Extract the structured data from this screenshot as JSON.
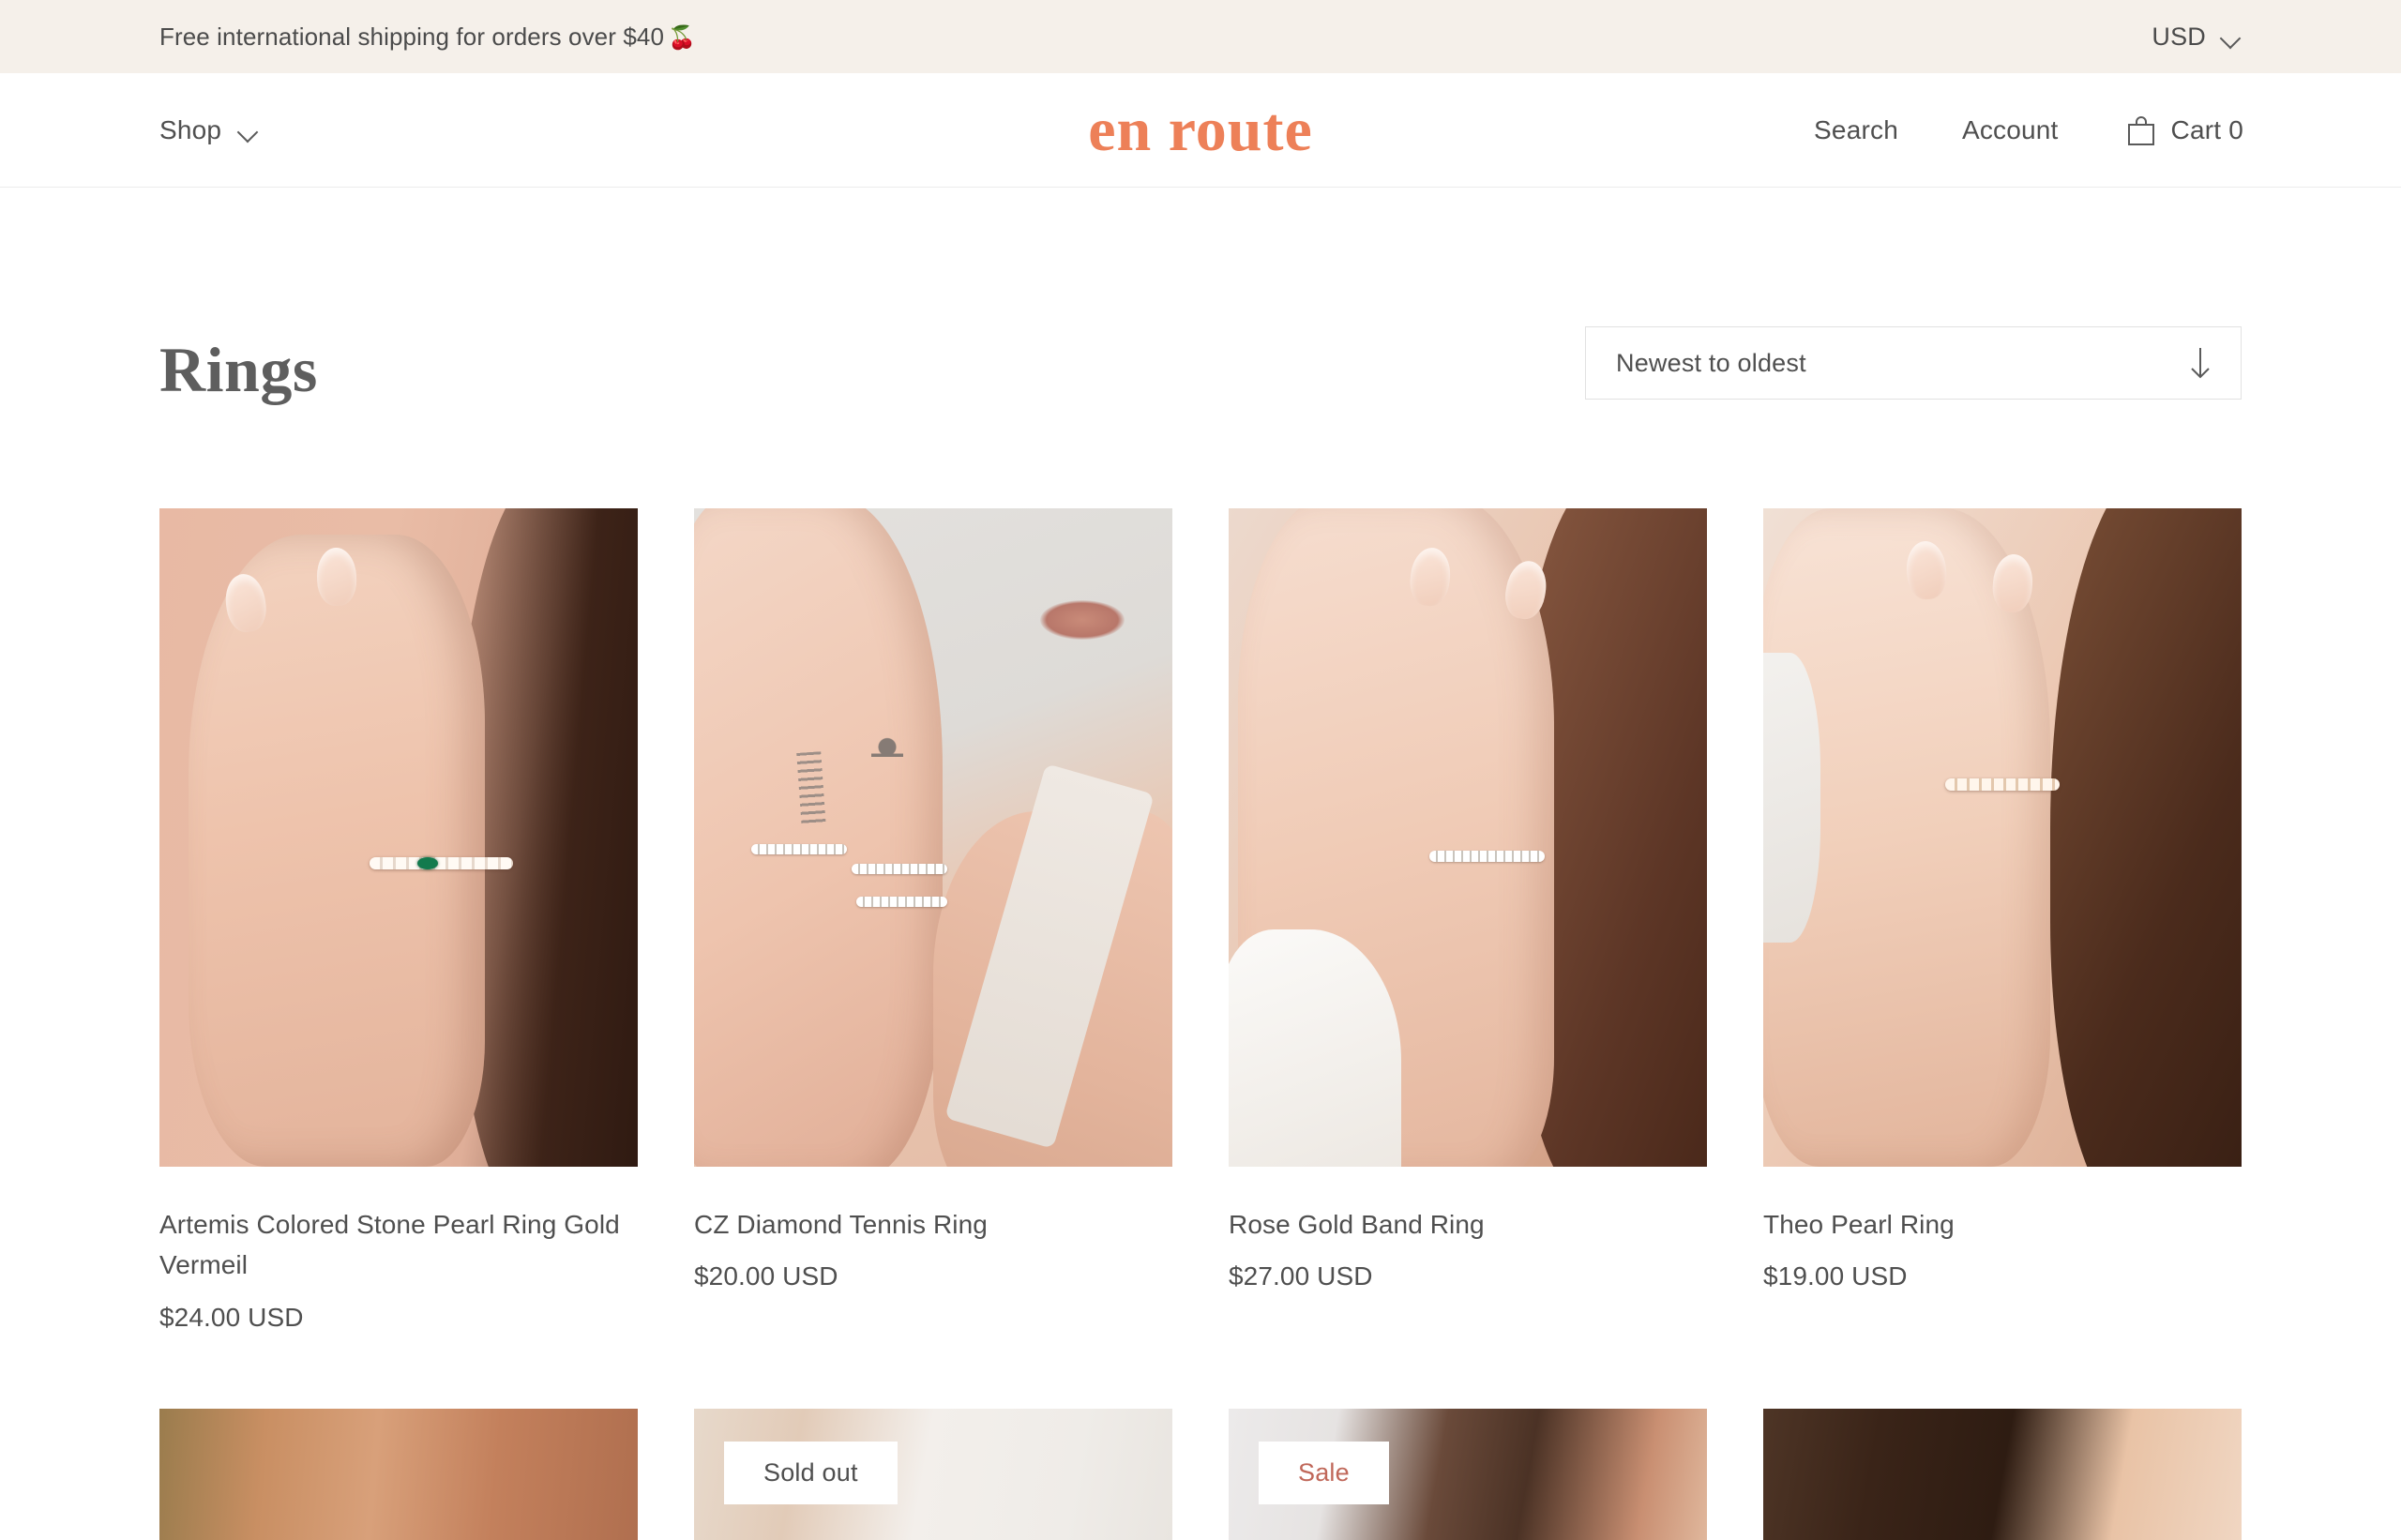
{
  "announcement": {
    "text": "Free international shipping for orders over $40",
    "emoji": "🍒",
    "emoji_name": "cherries-icon",
    "background": "#F5F0EA",
    "currency": {
      "label": "USD",
      "icon": "chevron-down-icon"
    }
  },
  "header": {
    "logo": "en route",
    "logo_color": "#ED8058",
    "nav_left": {
      "label": "Shop",
      "icon": "chevron-down-icon"
    },
    "nav_right": {
      "search": "Search",
      "account": "Account",
      "cart_icon": "shopping-bag-icon",
      "cart": "Cart 0",
      "cart_count": 0
    }
  },
  "collection": {
    "title": "Rings",
    "sort": {
      "selected": "Newest to oldest",
      "icon": "arrow-down-icon",
      "options": [
        "Newest to oldest"
      ]
    }
  },
  "products": [
    {
      "title": "Artemis Colored Stone Pearl Ring Gold Vermeil",
      "price": "$24.00 USD",
      "badge": null,
      "image_alt": "hand wearing pearl ring with green stone beside face"
    },
    {
      "title": "CZ Diamond Tennis Ring",
      "price": "$20.00 USD",
      "badge": null,
      "image_alt": "two hands with tattooed fingers wearing sparkling tennis rings"
    },
    {
      "title": "Rose Gold Band Ring",
      "price": "$27.00 USD",
      "badge": null,
      "image_alt": "hand at neck wearing a thin sparkling band ring"
    },
    {
      "title": "Theo Pearl Ring",
      "price": "$19.00 USD",
      "badge": null,
      "image_alt": "hand on chest wearing a pearl ring"
    }
  ],
  "products_row2": [
    {
      "badge": null,
      "image_alt": "close-up of skin and arm"
    },
    {
      "badge": "Sold out",
      "badge_type": "sold-out",
      "image_alt": "shoulder and white fabric"
    },
    {
      "badge": "Sale",
      "badge_type": "sale",
      "image_alt": "neck and dark hair"
    },
    {
      "badge": null,
      "image_alt": "dark hair over shoulder"
    }
  ],
  "colors": {
    "accent": "#ED8058",
    "sale": "#C0685A",
    "text": "#4F4F4F",
    "announcement_bg": "#F5F0EA",
    "border": "#E2E2E2"
  }
}
